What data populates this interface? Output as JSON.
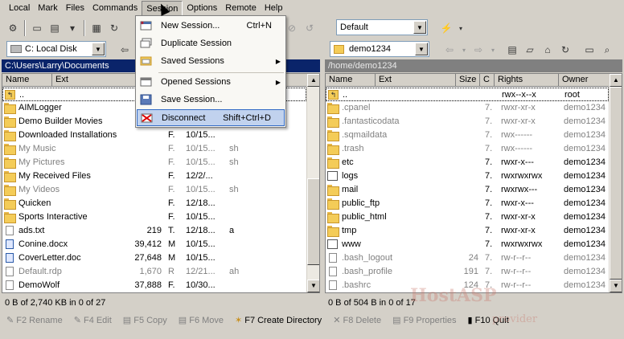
{
  "menubar": [
    "Local",
    "Mark",
    "Files",
    "Commands",
    "Session",
    "Options",
    "Remote",
    "Help"
  ],
  "toolbar": {
    "profile_value": "Default",
    "left_drive": "C: Local Disk",
    "right_dir": "demo1234"
  },
  "left_panel": {
    "path": "C:\\Users\\Larry\\Documents",
    "headers": [
      "Name",
      "Ext"
    ],
    "rows": [
      {
        "name": "..",
        "size": "",
        "type": "",
        "changed": "",
        "attr": "",
        "icon": "up"
      },
      {
        "name": "AIMLogger",
        "size": "",
        "type": "",
        "changed": "",
        "attr": "",
        "icon": "folder"
      },
      {
        "name": "Demo Builder Movies",
        "size": "",
        "type": "",
        "changed": "",
        "attr": "",
        "icon": "folder"
      },
      {
        "name": "Downloaded Installations",
        "size": "",
        "type": "F.",
        "changed": "10/15...",
        "attr": "",
        "icon": "folder"
      },
      {
        "name": "My Music",
        "size": "",
        "type": "F.",
        "changed": "10/15...",
        "attr": "sh",
        "icon": "folder",
        "gray": true
      },
      {
        "name": "My Pictures",
        "size": "",
        "type": "F.",
        "changed": "10/15...",
        "attr": "sh",
        "icon": "folder",
        "gray": true
      },
      {
        "name": "My Received Files",
        "size": "",
        "type": "F.",
        "changed": "12/2/...",
        "attr": "",
        "icon": "folder"
      },
      {
        "name": "My Videos",
        "size": "",
        "type": "F.",
        "changed": "10/15...",
        "attr": "sh",
        "icon": "folder",
        "gray": true
      },
      {
        "name": "Quicken",
        "size": "",
        "type": "F.",
        "changed": "12/18...",
        "attr": "",
        "icon": "folder"
      },
      {
        "name": "Sports Interactive",
        "size": "",
        "type": "F.",
        "changed": "10/15...",
        "attr": "",
        "icon": "folder"
      },
      {
        "name": "ads.txt",
        "size": "219",
        "type": "T.",
        "changed": "12/18...",
        "attr": "a",
        "icon": "file"
      },
      {
        "name": "Conine.docx",
        "size": "39,412",
        "type": "M",
        "changed": "10/15...",
        "attr": "",
        "icon": "doc"
      },
      {
        "name": "CoverLetter.doc",
        "size": "27,648",
        "type": "M",
        "changed": "10/15...",
        "attr": "",
        "icon": "doc"
      },
      {
        "name": "Default.rdp",
        "size": "1,670",
        "type": "R",
        "changed": "12/21...",
        "attr": "ah",
        "icon": "file",
        "gray": true
      },
      {
        "name": "DemoWolf",
        "size": "37,888",
        "type": "F.",
        "changed": "10/30...",
        "attr": "",
        "icon": "file"
      }
    ],
    "status": "0 B of 2,740 KB in 0 of 27"
  },
  "right_panel": {
    "path": "/home/demo1234",
    "headers": [
      "Name",
      "Ext",
      "Size",
      "C",
      "Rights",
      "Owner"
    ],
    "rows": [
      {
        "name": "..",
        "size": "",
        "c": "",
        "rights": "rwx--x--x",
        "owner": "root",
        "icon": "up"
      },
      {
        "name": ".cpanel",
        "size": "",
        "c": "7.",
        "rights": "rwxr-xr-x",
        "owner": "demo1234",
        "icon": "folder",
        "gray": true
      },
      {
        "name": ".fantasticodata",
        "size": "",
        "c": "7.",
        "rights": "rwxr-xr-x",
        "owner": "demo1234",
        "icon": "folder",
        "gray": true
      },
      {
        "name": ".sqmaildata",
        "size": "",
        "c": "7.",
        "rights": "rwx------",
        "owner": "demo1234",
        "icon": "folder",
        "gray": true
      },
      {
        "name": ".trash",
        "size": "",
        "c": "7.",
        "rights": "rwx------",
        "owner": "demo1234",
        "icon": "folder",
        "gray": true
      },
      {
        "name": "etc",
        "size": "",
        "c": "7.",
        "rights": "rwxr-x---",
        "owner": "demo1234",
        "icon": "folder"
      },
      {
        "name": "logs",
        "size": "",
        "c": "7.",
        "rights": "rwxrwxrwx",
        "owner": "demo1234",
        "icon": "link"
      },
      {
        "name": "mail",
        "size": "",
        "c": "7.",
        "rights": "rwxrwx---",
        "owner": "demo1234",
        "icon": "folder"
      },
      {
        "name": "public_ftp",
        "size": "",
        "c": "7.",
        "rights": "rwxr-x---",
        "owner": "demo1234",
        "icon": "folder"
      },
      {
        "name": "public_html",
        "size": "",
        "c": "7.",
        "rights": "rwxr-xr-x",
        "owner": "demo1234",
        "icon": "folder"
      },
      {
        "name": "tmp",
        "size": "",
        "c": "7.",
        "rights": "rwxr-xr-x",
        "owner": "demo1234",
        "icon": "folder"
      },
      {
        "name": "www",
        "size": "",
        "c": "7.",
        "rights": "rwxrwxrwx",
        "owner": "demo1234",
        "icon": "link"
      },
      {
        "name": ".bash_logout",
        "size": "24",
        "c": "7.",
        "rights": "rw-r--r--",
        "owner": "demo1234",
        "icon": "file",
        "gray": true
      },
      {
        "name": ".bash_profile",
        "size": "191",
        "c": "7.",
        "rights": "rw-r--r--",
        "owner": "demo1234",
        "icon": "file",
        "gray": true
      },
      {
        "name": ".bashrc",
        "size": "124",
        "c": "7.",
        "rights": "rw-r--r--",
        "owner": "demo1234",
        "icon": "file",
        "gray": true
      }
    ],
    "status": "0 B of 504 B in 0 of 17"
  },
  "session_menu": {
    "items": [
      {
        "label": "New Session...",
        "shortcut": "Ctrl+N",
        "icon": "new-session-icon"
      },
      {
        "label": "Duplicate Session",
        "shortcut": "",
        "icon": "duplicate-session-icon"
      },
      {
        "label": "Saved Sessions",
        "shortcut": "",
        "submenu": true,
        "icon": "saved-sessions-icon"
      },
      {
        "label": "Opened Sessions",
        "shortcut": "",
        "submenu": true,
        "icon": "opened-sessions-icon"
      },
      {
        "label": "Save Session...",
        "shortcut": "",
        "icon": "save-session-icon"
      },
      {
        "label": "Disconnect",
        "shortcut": "Shift+Ctrl+D",
        "icon": "disconnect-icon",
        "highlighted": true
      }
    ]
  },
  "fkeys": [
    {
      "key": "F2",
      "label": "Rename",
      "enabled": false
    },
    {
      "key": "F4",
      "label": "Edit",
      "enabled": false
    },
    {
      "key": "F5",
      "label": "Copy",
      "enabled": false
    },
    {
      "key": "F6",
      "label": "Move",
      "enabled": false
    },
    {
      "key": "F7",
      "label": "Create Directory",
      "enabled": true
    },
    {
      "key": "F8",
      "label": "Delete",
      "enabled": false
    },
    {
      "key": "F9",
      "label": "Properties",
      "enabled": false
    },
    {
      "key": "F10",
      "label": "Quit",
      "enabled": true
    }
  ],
  "watermark": {
    "brand": "HostASP",
    "tagline": "provider"
  },
  "colors": {
    "active_path_bg": "#0a246a",
    "inactive_path_bg": "#808080",
    "menu_highlight": "#c1d2ee"
  }
}
